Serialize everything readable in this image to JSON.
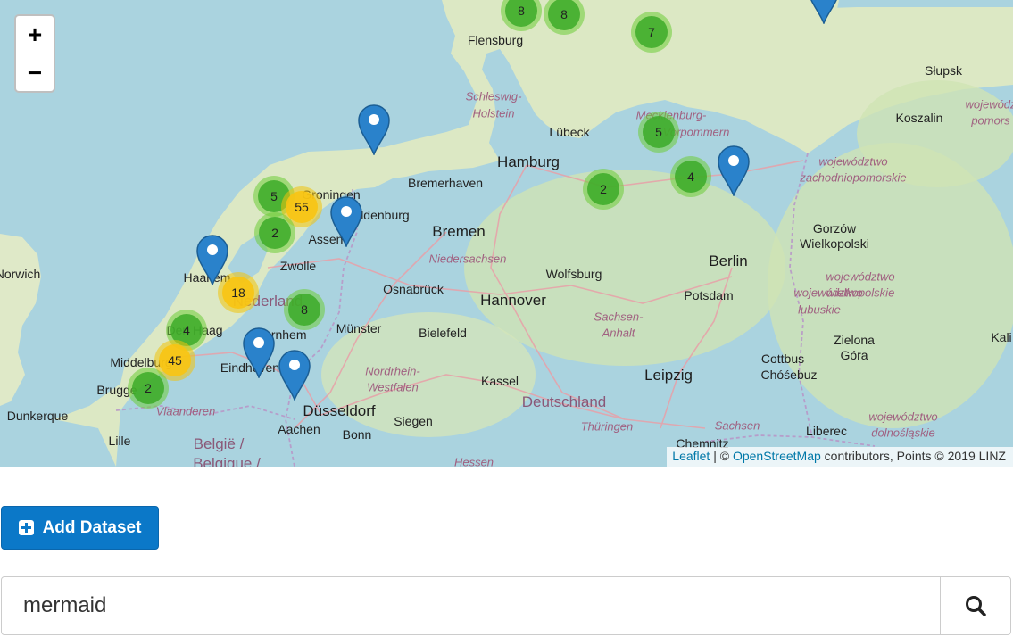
{
  "map": {
    "zoom_in": "+",
    "zoom_out": "−",
    "attribution": {
      "leaflet": "Leaflet",
      "separator": " | © ",
      "osm": "OpenStreetMap",
      "suffix": " contributors, Points © 2019 LINZ"
    },
    "labels": [
      {
        "text": "Flensburg",
        "kind": "city"
      },
      {
        "text": "Schleswig-",
        "kind": "region"
      },
      {
        "text": "Holstein",
        "kind": "region"
      },
      {
        "text": "Lübeck",
        "kind": "city"
      },
      {
        "text": "Hamburg",
        "kind": "major"
      },
      {
        "text": "Bremerhaven",
        "kind": "city"
      },
      {
        "text": "Groningen",
        "kind": "city"
      },
      {
        "text": "Oldenburg",
        "kind": "city"
      },
      {
        "text": "Assen",
        "kind": "city"
      },
      {
        "text": "Bremen",
        "kind": "major"
      },
      {
        "text": "Niedersachsen",
        "kind": "region"
      },
      {
        "text": "Zwolle",
        "kind": "city"
      },
      {
        "text": "Haarlem",
        "kind": "city"
      },
      {
        "text": "Nederland",
        "kind": "country"
      },
      {
        "text": "Osnabrück",
        "kind": "city"
      },
      {
        "text": "Hannover",
        "kind": "major"
      },
      {
        "text": "Wolfsburg",
        "kind": "city"
      },
      {
        "text": "Berlin",
        "kind": "major"
      },
      {
        "text": "Potsdam",
        "kind": "city"
      },
      {
        "text": "Sachsen-",
        "kind": "region"
      },
      {
        "text": "Anhalt",
        "kind": "region"
      },
      {
        "text": "Den Haag",
        "kind": "city"
      },
      {
        "text": "Arnhem",
        "kind": "city"
      },
      {
        "text": "Münster",
        "kind": "city"
      },
      {
        "text": "Bielefeld",
        "kind": "city"
      },
      {
        "text": "Middelburg",
        "kind": "city"
      },
      {
        "text": "Eindhoven",
        "kind": "city"
      },
      {
        "text": "Nordrhein-",
        "kind": "region"
      },
      {
        "text": "Westfalen",
        "kind": "region"
      },
      {
        "text": "Kassel",
        "kind": "city"
      },
      {
        "text": "Leipzig",
        "kind": "major"
      },
      {
        "text": "Cottbus",
        "kind": "city"
      },
      {
        "text": "Chóśebuz",
        "kind": "city"
      },
      {
        "text": "Brugge",
        "kind": "city"
      },
      {
        "text": "Düsseldorf",
        "kind": "major"
      },
      {
        "text": "Deutschland",
        "kind": "country"
      },
      {
        "text": "Dunkerque",
        "kind": "city"
      },
      {
        "text": "Vlaanderen",
        "kind": "region"
      },
      {
        "text": "Aachen",
        "kind": "city"
      },
      {
        "text": "Siegen",
        "kind": "city"
      },
      {
        "text": "Thüringen",
        "kind": "region"
      },
      {
        "text": "Sachsen",
        "kind": "region"
      },
      {
        "text": "Lille",
        "kind": "city"
      },
      {
        "text": "België /",
        "kind": "country"
      },
      {
        "text": "Belgique /",
        "kind": "country"
      },
      {
        "text": "Bonn",
        "kind": "city"
      },
      {
        "text": "Hessen",
        "kind": "region"
      },
      {
        "text": "Chemnitz",
        "kind": "city"
      },
      {
        "text": "Liberec",
        "kind": "city"
      },
      {
        "text": "Norwich",
        "kind": "city"
      },
      {
        "text": "Słupsk",
        "kind": "city"
      },
      {
        "text": "Koszalin",
        "kind": "city"
      },
      {
        "text": "wojewódz",
        "kind": "region"
      },
      {
        "text": "pomors",
        "kind": "region"
      },
      {
        "text": "województwo",
        "kind": "region"
      },
      {
        "text": "zachodniopomorskie",
        "kind": "region"
      },
      {
        "text": "Gorzów",
        "kind": "city"
      },
      {
        "text": "Wielkopolski",
        "kind": "city"
      },
      {
        "text": "województwo",
        "kind": "region"
      },
      {
        "text": "wielkopolskie",
        "kind": "region"
      },
      {
        "text": "województwo",
        "kind": "region"
      },
      {
        "text": "lubuskie",
        "kind": "region"
      },
      {
        "text": "Zielona",
        "kind": "city"
      },
      {
        "text": "Góra",
        "kind": "city"
      },
      {
        "text": "Kali",
        "kind": "city"
      },
      {
        "text": "województwo",
        "kind": "region"
      },
      {
        "text": "dolnośląskie",
        "kind": "region"
      },
      {
        "text": "Mecklenburg-",
        "kind": "region"
      },
      {
        "text": "Vorpommern",
        "kind": "region"
      }
    ],
    "clusters": [
      {
        "count": "8",
        "level": "green"
      },
      {
        "count": "8",
        "level": "green"
      },
      {
        "count": "7",
        "level": "green"
      },
      {
        "count": "5",
        "level": "green"
      },
      {
        "count": "2",
        "level": "green"
      },
      {
        "count": "4",
        "level": "green"
      },
      {
        "count": "5",
        "level": "green"
      },
      {
        "count": "55",
        "level": "yellow"
      },
      {
        "count": "2",
        "level": "green"
      },
      {
        "count": "18",
        "level": "yellow"
      },
      {
        "count": "8",
        "level": "green"
      },
      {
        "count": "4",
        "level": "green"
      },
      {
        "count": "45",
        "level": "yellow"
      },
      {
        "count": "2",
        "level": "green"
      }
    ],
    "markers": 7,
    "colors": {
      "water": "#aad3df",
      "land": "#d8e9c2",
      "marker": "#2a82cb",
      "cluster_green": "#6ecc39",
      "cluster_yellow": "#f0c20c"
    }
  },
  "toolbar": {
    "add_dataset_label": "Add Dataset"
  },
  "search": {
    "value": "mermaid"
  }
}
